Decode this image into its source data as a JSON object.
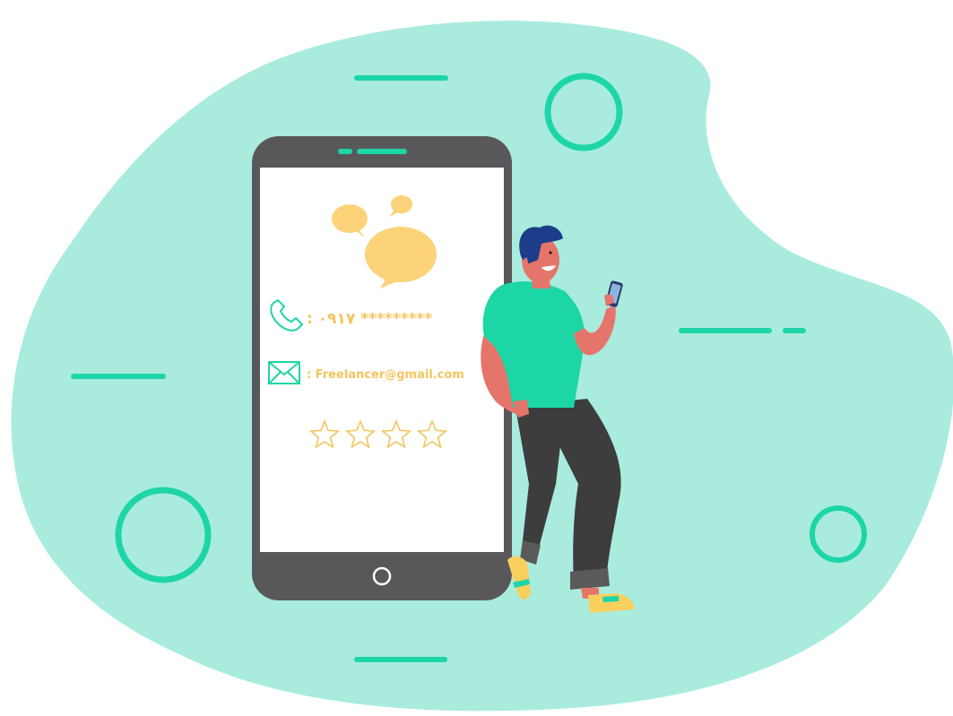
{
  "colors": {
    "blob": "#a9ecdd",
    "accent": "#1ed5a8",
    "phone_body": "#58585a",
    "screen": "#ffffff",
    "bubble": "#fcd37a",
    "text_gold": "#f2c55f",
    "shirt": "#1cd6a5",
    "skin": "#e5746b",
    "pants": "#3d3d3d",
    "hair": "#1d3d8a",
    "shoe": "#f9cf5d"
  },
  "phone": {
    "phone_number": ": ۰۹۱۷ *********",
    "email": ": Freelancer@gmail.com",
    "rating": {
      "max": 4,
      "filled": 0
    }
  },
  "icons": {
    "phone": "phone-handset-icon",
    "email": "envelope-icon",
    "home": "home-button-icon",
    "speaker": "speaker-grille-icon",
    "chat": "chat-bubbles-icon",
    "star": "star-outline-icon"
  }
}
